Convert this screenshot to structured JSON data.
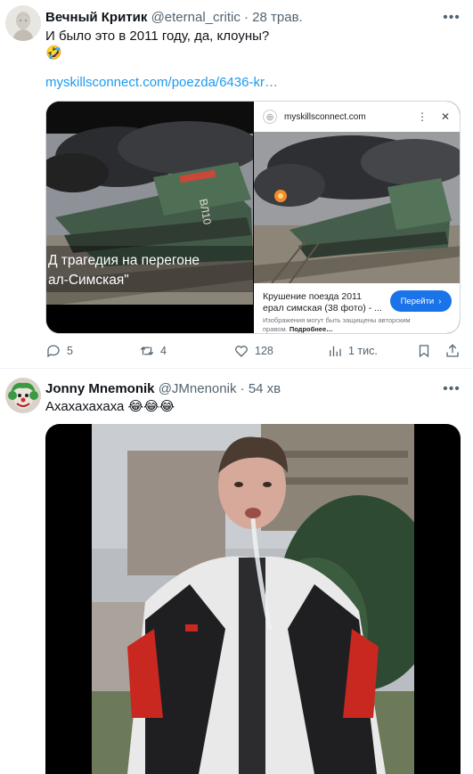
{
  "tweets": [
    {
      "author": {
        "name": "Вечный Критик",
        "handle": "@eternal_critic",
        "time": "28 трав."
      },
      "text": "И было это в 2011 году, да, клоуны?",
      "emoji": "🤣",
      "link": "myskillsconnect.com/poezda/6436-kr…",
      "media": {
        "overlay_caption_line1": "Д трагедия на перегоне",
        "overlay_caption_line2": "ал-Симская\"",
        "locomotive_number": "ВЛ10",
        "lens_site": "myskillsconnect.com",
        "lens_title": "Крушение поезда 2011 ерал симская (38 фото) - ...",
        "lens_button": "Перейти",
        "lens_note": "Изображения могут быть защищены авторским правом.",
        "lens_note_more": "Подробнее…"
      },
      "actions": {
        "replies": "5",
        "reposts": "4",
        "likes": "128",
        "views": "1 тис."
      }
    },
    {
      "author": {
        "name": "Jonny Mnemonik",
        "handle": "@JMnenonik",
        "time": "54 хв"
      },
      "text": "Ахахахахаха",
      "emoji": "😂😂😂"
    }
  ],
  "separator": "·",
  "more_glyph": "•••",
  "colors": {
    "link": "#1d9bf0",
    "secondary_text": "#536471",
    "lens_button": "#1a73e8"
  },
  "icons": [
    "avatar-statue",
    "avatar-clown",
    "more-icon",
    "reply-icon",
    "repost-icon",
    "like-icon",
    "views-icon",
    "bookmark-icon",
    "share-icon",
    "site-globe-icon",
    "lens-options-icon",
    "lens-close-icon"
  ]
}
